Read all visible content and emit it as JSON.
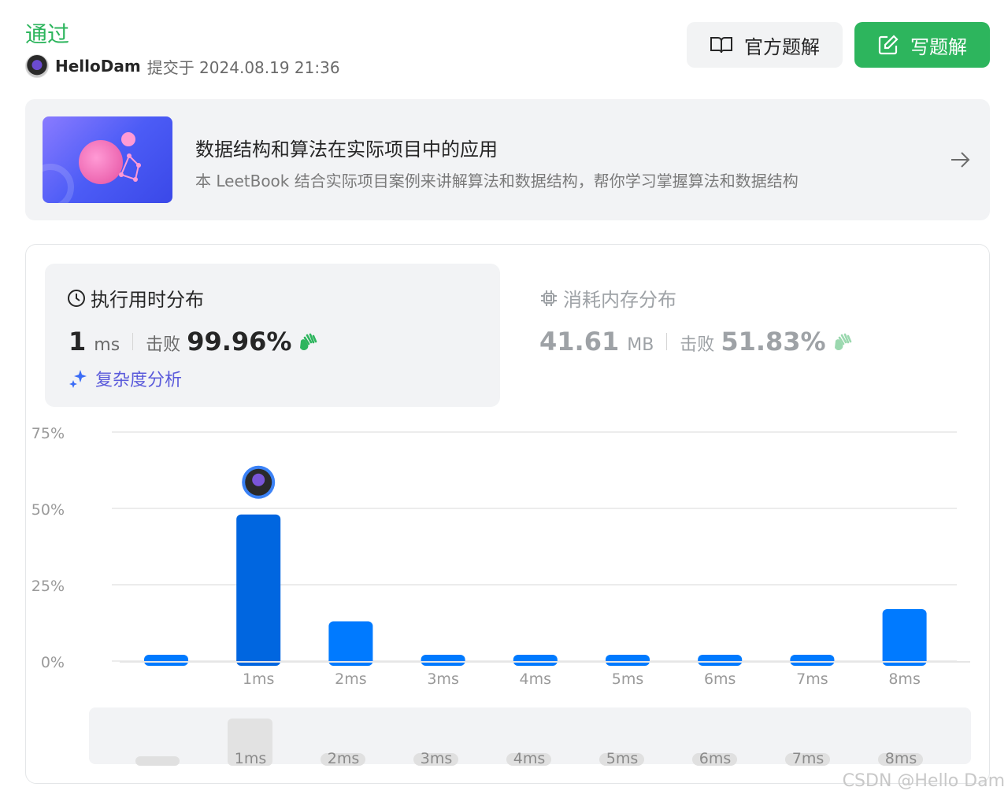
{
  "status": {
    "title": "通过"
  },
  "submitter": {
    "name": "HelloDam",
    "info": "提交于 2024.08.19 21:36"
  },
  "buttons": {
    "official_solution": "官方题解",
    "write_solution": "写题解"
  },
  "leetbook": {
    "title": "数据结构和算法在实际项目中的应用",
    "description": "本 LeetBook 结合实际项目案例来讲解算法和数据结构，帮你学习掌握算法和数据结构"
  },
  "runtime": {
    "title": "执行用时分布",
    "value": "1",
    "unit": "ms",
    "beats_label": "击败",
    "beats_pct": "99.96%",
    "complexity_link": "复杂度分析"
  },
  "memory": {
    "title": "消耗内存分布",
    "value": "41.61",
    "unit": "MB",
    "beats_label": "击败",
    "beats_pct": "51.83%"
  },
  "colors": {
    "accent_green": "#2db55d",
    "bar_blue": "#007aff",
    "bar_selected": "#0066e0"
  },
  "chart_data": {
    "type": "bar",
    "categories": [
      "",
      "1ms",
      "2ms",
      "3ms",
      "4ms",
      "5ms",
      "6ms",
      "7ms",
      "8ms"
    ],
    "values": [
      0.5,
      48,
      13,
      0.5,
      0.5,
      0.5,
      0.5,
      1,
      17
    ],
    "y_ticks": [
      "75%",
      "50%",
      "25%",
      "0%"
    ],
    "ylim": [
      0,
      75
    ],
    "selected_category": "1ms",
    "grid": true,
    "overview_labels": [
      "1ms",
      "2ms",
      "3ms",
      "4ms",
      "5ms",
      "6ms",
      "7ms",
      "8ms"
    ],
    "watermark": "CSDN @Hello Dam"
  }
}
